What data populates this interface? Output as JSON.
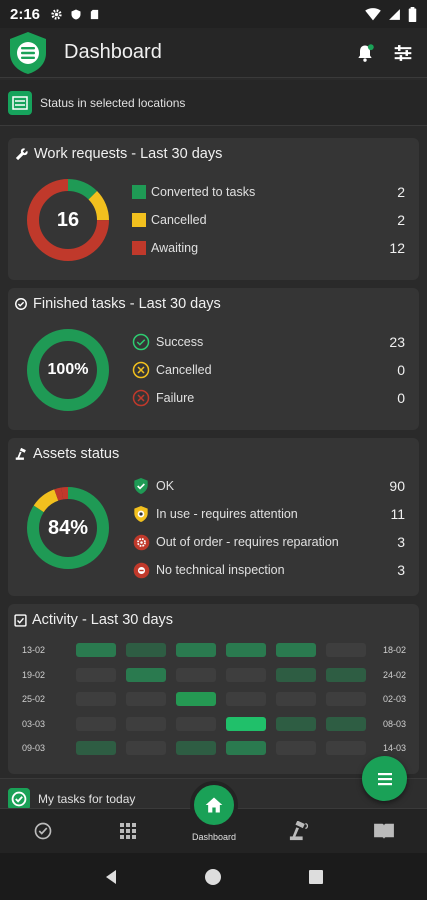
{
  "status_bar": {
    "time": "2:16"
  },
  "app_bar": {
    "title": "Dashboard"
  },
  "location_bar": {
    "label": "Status in selected locations"
  },
  "work_requests": {
    "title": "Work requests - Last 30 days",
    "total": "16",
    "items": [
      {
        "label": "Converted to tasks",
        "value": "2",
        "color": "#1f9a55"
      },
      {
        "label": "Cancelled",
        "value": "2",
        "color": "#f2c01e"
      },
      {
        "label": "Awaiting",
        "value": "12",
        "color": "#c0392b"
      }
    ]
  },
  "finished_tasks": {
    "title": "Finished tasks - Last 30 days",
    "total": "100%",
    "items": [
      {
        "label": "Success",
        "value": "23",
        "icon": "check-circle-icon",
        "color": "#2ecc71"
      },
      {
        "label": "Cancelled",
        "value": "0",
        "icon": "cancel-circle-icon",
        "color": "#f2c01e"
      },
      {
        "label": "Failure",
        "value": "0",
        "icon": "failure-circle-icon",
        "color": "#c0392b"
      }
    ]
  },
  "assets_status": {
    "title": "Assets status",
    "total": "84%",
    "items": [
      {
        "label": "OK",
        "value": "90",
        "icon": "shield-ok-icon",
        "color": "#1f9a55"
      },
      {
        "label": "In use - requires attention",
        "value": "11",
        "icon": "shield-attention-icon",
        "color": "#f2c01e"
      },
      {
        "label": "Out of order - requires reparation",
        "value": "3",
        "icon": "out-of-order-icon",
        "color": "#c0392b"
      },
      {
        "label": "No technical inspection",
        "value": "3",
        "icon": "no-inspection-icon",
        "color": "#c0392b"
      }
    ]
  },
  "activity": {
    "title": "Activity - Last 30 days",
    "rows": [
      {
        "start": "13-02",
        "end": "18-02",
        "levels": [
          2,
          1,
          2,
          2,
          2,
          0
        ]
      },
      {
        "start": "19-02",
        "end": "24-02",
        "levels": [
          0,
          2,
          0,
          0,
          1,
          1
        ]
      },
      {
        "start": "25-02",
        "end": "02-03",
        "levels": [
          0,
          0,
          3,
          0,
          0,
          0
        ]
      },
      {
        "start": "03-03",
        "end": "08-03",
        "levels": [
          0,
          0,
          0,
          4,
          1,
          1
        ]
      },
      {
        "start": "09-03",
        "end": "14-03",
        "levels": [
          1,
          0,
          1,
          2,
          0,
          0
        ]
      }
    ]
  },
  "peek_section": {
    "label": "My tasks for today"
  },
  "bottom_nav": {
    "home_label": "Dashboard"
  },
  "colors": {
    "accent": "#1aa157",
    "background": "#2a2a2a",
    "card": "#353535"
  }
}
